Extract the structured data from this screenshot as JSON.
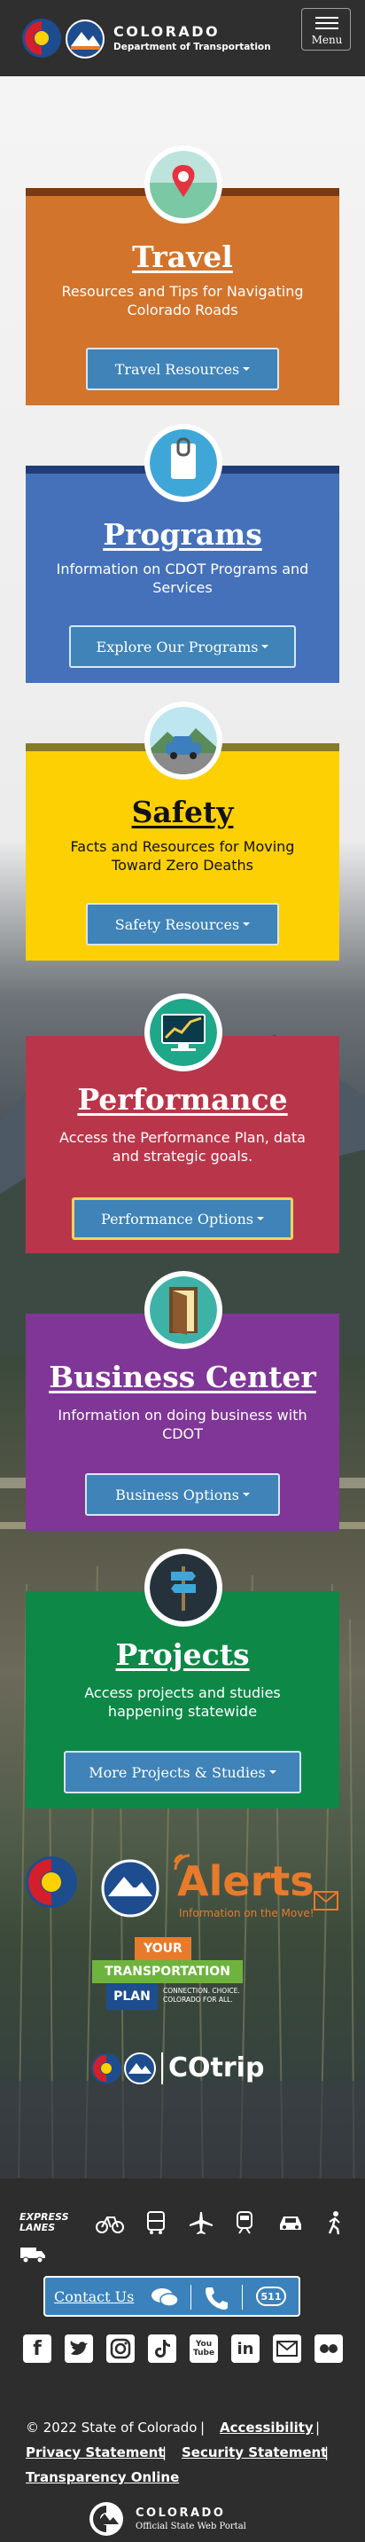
{
  "header": {
    "brand_title": "COLORADO",
    "brand_subtitle": "Department of Transportation",
    "menu_label": "Menu"
  },
  "cards": [
    {
      "title": "Travel",
      "description": "Resources and Tips for Navigating Colorado Roads",
      "button": "Travel Resources",
      "icon": "map-pin-icon",
      "color": "#d2742c",
      "stripe": "#7a3a15"
    },
    {
      "title": "Programs",
      "description": "Information on CDOT Programs and Services",
      "button": "Explore Our Programs",
      "icon": "clipboard-icon",
      "color": "#4471ba",
      "stripe": "#1f3d78"
    },
    {
      "title": "Safety",
      "description": "Facts and Resources for Moving Toward Zero Deaths",
      "button": "Safety Resources",
      "icon": "car-icon",
      "color": "#fdd003",
      "stripe": "#857b2c"
    },
    {
      "title": "Performance",
      "description": "Access the Performance Plan, data and strategic goals.",
      "button": "Performance Options",
      "icon": "chart-monitor-icon",
      "color": "#b9364a",
      "stripe": "#b9364a"
    },
    {
      "title": "Business Center",
      "description": "Information on doing business with CDOT",
      "button": "Business Options",
      "icon": "open-door-icon",
      "color": "#7f3696",
      "stripe": "#7f3696"
    },
    {
      "title": "Projects",
      "description": "Access projects and studies happening statewide",
      "button": "More Projects & Studies",
      "icon": "signpost-icon",
      "color": "#0d8847",
      "stripe": "#0d8847"
    }
  ],
  "promos": {
    "alerts": {
      "logo_text": "CDOT",
      "title": "Alerts",
      "tagline": "Information on the Move!"
    },
    "plan": {
      "line1": "YOUR",
      "line2": "TRANSPORTATION",
      "line3": "PLAN",
      "tagline": "CONNECTION. CHOICE. COLORADO FOR ALL."
    },
    "cotrip": {
      "title": "COtrip"
    }
  },
  "footer": {
    "travel_modes": [
      "express-lanes-icon",
      "bicycle-icon",
      "bus-icon",
      "airplane-icon",
      "train-icon",
      "car-icon",
      "pedestrian-icon",
      "truck-icon"
    ],
    "express_lanes_label": "EXPRESS LANES",
    "contact_label": "Contact Us",
    "contact_icons": [
      "chat-icon",
      "phone-icon",
      "511-icon"
    ],
    "contact_511": "511",
    "social": [
      "facebook-icon",
      "twitter-icon",
      "instagram-icon",
      "tiktok-icon",
      "youtube-icon",
      "linkedin-icon",
      "email-icon",
      "flickr-icon"
    ],
    "social_glyphs": [
      "f",
      "",
      "",
      "",
      "You Tube",
      "in",
      "",
      ""
    ],
    "copyright": "© 2022 State of Colorado",
    "links": [
      "Accessibility",
      "Privacy Statement",
      "Security Statement",
      "Transparency Online"
    ],
    "portal_title": "COLORADO",
    "portal_subtitle": "Official State Web Portal"
  }
}
